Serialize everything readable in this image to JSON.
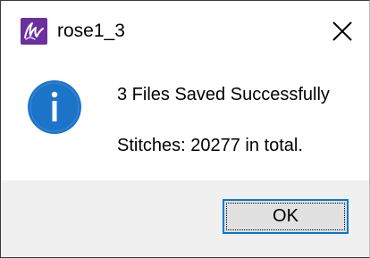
{
  "window": {
    "title": "rose1_3",
    "app_icon": "app-logo-icon",
    "close_icon": "close-icon"
  },
  "message": {
    "icon": "info-icon",
    "line1": "3 Files Saved Successfully",
    "line2": "Stitches: 20277 in total."
  },
  "buttons": {
    "ok_label": "OK"
  },
  "colors": {
    "accent": "#0078d7",
    "info_icon": "#1c74c9",
    "app_icon": "#6b2f9e",
    "footer_bg": "#f0f0f0"
  }
}
